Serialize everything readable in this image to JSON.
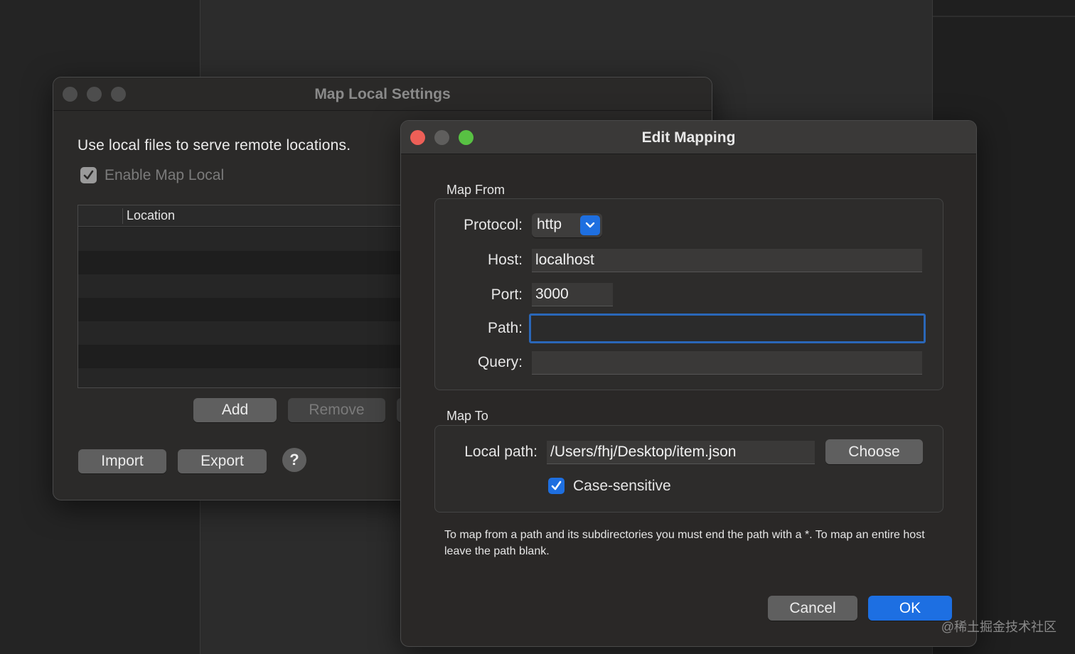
{
  "map_local_window": {
    "title": "Map Local Settings",
    "description": "Use local files to serve remote locations.",
    "enable_label": "Enable Map Local",
    "enable_checked": true,
    "table": {
      "column_header": "Location",
      "rows": []
    },
    "buttons": {
      "add": "Add",
      "remove": "Remove",
      "import": "Import",
      "export": "Export",
      "help": "?"
    }
  },
  "edit_mapping_window": {
    "title": "Edit Mapping",
    "map_from": {
      "section_label": "Map From",
      "protocol_label": "Protocol:",
      "protocol_value": "http",
      "host_label": "Host:",
      "host_value": "localhost",
      "port_label": "Port:",
      "port_value": "3000",
      "path_label": "Path:",
      "path_value": "",
      "query_label": "Query:",
      "query_value": ""
    },
    "map_to": {
      "section_label": "Map To",
      "local_path_label": "Local path:",
      "local_path_value": "/Users/fhj/Desktop/item.json",
      "choose_button": "Choose",
      "case_sensitive_label": "Case-sensitive",
      "case_sensitive_checked": true
    },
    "help_text": "To map from a path and its subdirectories you must end the path with a *. To map an entire host leave the path blank.",
    "buttons": {
      "cancel": "Cancel",
      "ok": "OK"
    }
  },
  "watermark": "@稀土掘金技术社区",
  "colors": {
    "accent": "#1e6fe0",
    "close": "#ed5f57",
    "minimize": "#5f5e5d",
    "zoom": "#58c143",
    "inactive_traffic": "#4d4d4d"
  }
}
